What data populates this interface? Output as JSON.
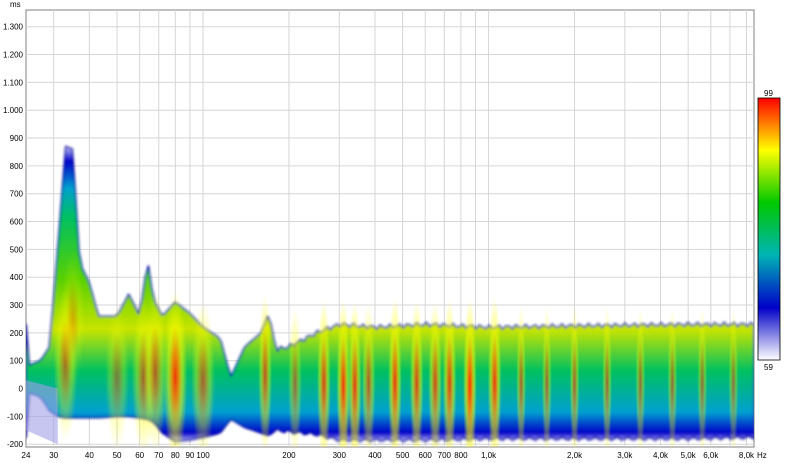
{
  "chart_data": {
    "type": "heatmap",
    "title": "",
    "xlabel": "Hz",
    "ylabel": "ms",
    "x_scale": "log",
    "xlim": [
      24,
      8500
    ],
    "ylim": [
      -210,
      1360
    ],
    "x_ticks": [
      {
        "value": 24,
        "label": "24"
      },
      {
        "value": 30,
        "label": "30"
      },
      {
        "value": 40,
        "label": "40"
      },
      {
        "value": 50,
        "label": "50"
      },
      {
        "value": 60,
        "label": "60"
      },
      {
        "value": 70,
        "label": "70"
      },
      {
        "value": 80,
        "label": "80"
      },
      {
        "value": 90,
        "label": "90"
      },
      {
        "value": 100,
        "label": "100"
      },
      {
        "value": 200,
        "label": "200"
      },
      {
        "value": 300,
        "label": "300"
      },
      {
        "value": 400,
        "label": "400"
      },
      {
        "value": 500,
        "label": "500"
      },
      {
        "value": 600,
        "label": "600"
      },
      {
        "value": 700,
        "label": "700"
      },
      {
        "value": 800,
        "label": "800"
      },
      {
        "value": 1000,
        "label": "1,0k"
      },
      {
        "value": 2000,
        "label": "2,0k"
      },
      {
        "value": 3000,
        "label": "3,0k"
      },
      {
        "value": 4000,
        "label": "4,0k"
      },
      {
        "value": 5000,
        "label": "5,0k"
      },
      {
        "value": 6000,
        "label": "6,0k"
      },
      {
        "value": 8000,
        "label": "8,0k"
      }
    ],
    "y_ticks": [
      {
        "value": -200,
        "label": "-200"
      },
      {
        "value": -100,
        "label": "-100"
      },
      {
        "value": 0,
        "label": "0"
      },
      {
        "value": 100,
        "label": "100"
      },
      {
        "value": 200,
        "label": "200"
      },
      {
        "value": 300,
        "label": "300"
      },
      {
        "value": 400,
        "label": "400"
      },
      {
        "value": 500,
        "label": "500"
      },
      {
        "value": 600,
        "label": "600"
      },
      {
        "value": 700,
        "label": "700"
      },
      {
        "value": 800,
        "label": "800"
      },
      {
        "value": 900,
        "label": "900"
      },
      {
        "value": 1000,
        "label": "1.000"
      },
      {
        "value": 1100,
        "label": "1.100"
      },
      {
        "value": 1200,
        "label": "1.200"
      },
      {
        "value": 1300,
        "label": "1.300"
      }
    ],
    "grid": true,
    "colorbar": {
      "min": 59,
      "max": 99,
      "min_label": "59",
      "max_label": "99",
      "colors": [
        "#ffffff",
        "#0000c8",
        "#00b4b4",
        "#00c800",
        "#ffff00",
        "#ff0000"
      ]
    },
    "envelope": [
      {
        "f": 24,
        "top": 80,
        "bottom": -10
      },
      {
        "f": 27,
        "top": 100,
        "bottom": -30
      },
      {
        "f": 29,
        "top": 150,
        "bottom": -80
      },
      {
        "f": 31,
        "top": 500,
        "bottom": -100
      },
      {
        "f": 33,
        "top": 870,
        "bottom": -105
      },
      {
        "f": 35,
        "top": 860,
        "bottom": -105
      },
      {
        "f": 37,
        "top": 450,
        "bottom": -105
      },
      {
        "f": 40,
        "top": 380,
        "bottom": -105
      },
      {
        "f": 43,
        "top": 260,
        "bottom": -105
      },
      {
        "f": 50,
        "top": 260,
        "bottom": -100
      },
      {
        "f": 55,
        "top": 340,
        "bottom": -100
      },
      {
        "f": 60,
        "top": 260,
        "bottom": -105
      },
      {
        "f": 64,
        "top": 460,
        "bottom": -110
      },
      {
        "f": 67,
        "top": 320,
        "bottom": -120
      },
      {
        "f": 72,
        "top": 260,
        "bottom": -160
      },
      {
        "f": 80,
        "top": 310,
        "bottom": -190
      },
      {
        "f": 90,
        "top": 270,
        "bottom": -185
      },
      {
        "f": 100,
        "top": 220,
        "bottom": -175
      },
      {
        "f": 115,
        "top": 180,
        "bottom": -160
      },
      {
        "f": 125,
        "top": 40,
        "bottom": -110
      },
      {
        "f": 140,
        "top": 150,
        "bottom": -140
      },
      {
        "f": 160,
        "top": 200,
        "bottom": -160
      },
      {
        "f": 170,
        "top": 270,
        "bottom": -170
      },
      {
        "f": 180,
        "top": 140,
        "bottom": -150
      },
      {
        "f": 200,
        "top": 150,
        "bottom": -155
      },
      {
        "f": 250,
        "top": 200,
        "bottom": -165
      },
      {
        "f": 300,
        "top": 230,
        "bottom": -185
      },
      {
        "f": 400,
        "top": 220,
        "bottom": -185
      },
      {
        "f": 600,
        "top": 230,
        "bottom": -185
      },
      {
        "f": 1000,
        "top": 220,
        "bottom": -180
      },
      {
        "f": 2000,
        "top": 225,
        "bottom": -180
      },
      {
        "f": 5000,
        "top": 230,
        "bottom": -180
      },
      {
        "f": 8500,
        "top": 230,
        "bottom": -175
      }
    ],
    "hotspots": [
      {
        "f": 33,
        "t": 90,
        "level": 0.78
      },
      {
        "f": 35,
        "t": 250,
        "level": 0.62
      },
      {
        "f": 50,
        "t": 40,
        "level": 0.7
      },
      {
        "f": 62,
        "t": 40,
        "level": 0.8
      },
      {
        "f": 68,
        "t": 60,
        "level": 0.82
      },
      {
        "f": 80,
        "t": 40,
        "level": 0.97
      },
      {
        "f": 100,
        "t": 30,
        "level": 0.8
      },
      {
        "f": 165,
        "t": 50,
        "level": 0.85
      },
      {
        "f": 210,
        "t": 20,
        "level": 0.75
      },
      {
        "f": 265,
        "t": 20,
        "level": 0.9
      },
      {
        "f": 310,
        "t": 10,
        "level": 0.96
      },
      {
        "f": 340,
        "t": 10,
        "level": 0.93
      },
      {
        "f": 380,
        "t": 20,
        "level": 0.82
      },
      {
        "f": 470,
        "t": 20,
        "level": 0.95
      },
      {
        "f": 560,
        "t": 20,
        "level": 0.9
      },
      {
        "f": 650,
        "t": 20,
        "level": 0.88
      },
      {
        "f": 730,
        "t": 20,
        "level": 0.92
      },
      {
        "f": 860,
        "t": 10,
        "level": 0.99
      },
      {
        "f": 1050,
        "t": 20,
        "level": 0.95
      },
      {
        "f": 1300,
        "t": 20,
        "level": 0.8
      },
      {
        "f": 1600,
        "t": 20,
        "level": 0.78
      },
      {
        "f": 2000,
        "t": 20,
        "level": 0.8
      },
      {
        "f": 2600,
        "t": 20,
        "level": 0.78
      },
      {
        "f": 3400,
        "t": 20,
        "level": 0.76
      },
      {
        "f": 4400,
        "t": 20,
        "level": 0.76
      },
      {
        "f": 5600,
        "t": 20,
        "level": 0.75
      },
      {
        "f": 7200,
        "t": 20,
        "level": 0.74
      }
    ]
  }
}
